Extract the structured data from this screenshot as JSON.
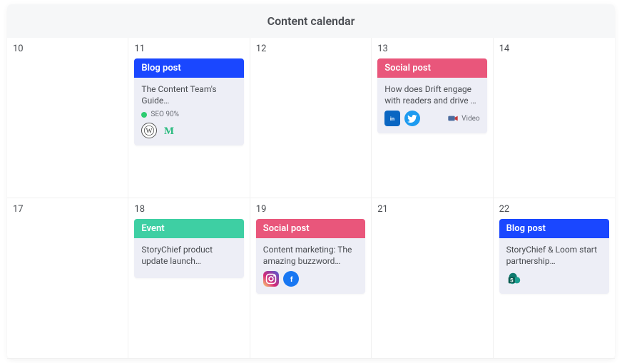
{
  "header": {
    "title": "Content calendar"
  },
  "labels": {
    "blog": "Blog post",
    "social": "Social post",
    "event": "Event",
    "seo": "SEO 90%",
    "video": "Video"
  },
  "days": {
    "d10": "10",
    "d11": "11",
    "d12": "12",
    "d13": "13",
    "d14": "14",
    "d17": "17",
    "d18": "18",
    "d19": "19",
    "d21": "21",
    "d22": "22"
  },
  "cards": {
    "d11": {
      "title": "The Content Team's Guide…"
    },
    "d13": {
      "title": "How does Drift engage with readers and drive …"
    },
    "d18": {
      "title": "StoryChief product update launch…"
    },
    "d19": {
      "title": "Content marketing: The amazing buzzword…"
    },
    "d22": {
      "title": "StoryChief & Loom start partnership…"
    }
  },
  "colors": {
    "blue": "#1a47ff",
    "pink": "#e9567b",
    "teal": "#3ecfa3"
  },
  "icons": {
    "wordpress": "wordpress-icon",
    "medium": "medium-icon",
    "linkedin": "linkedin-icon",
    "twitter": "twitter-icon",
    "instagram": "instagram-icon",
    "facebook": "facebook-icon",
    "sharepoint": "sharepoint-icon",
    "camera": "camera-icon"
  }
}
